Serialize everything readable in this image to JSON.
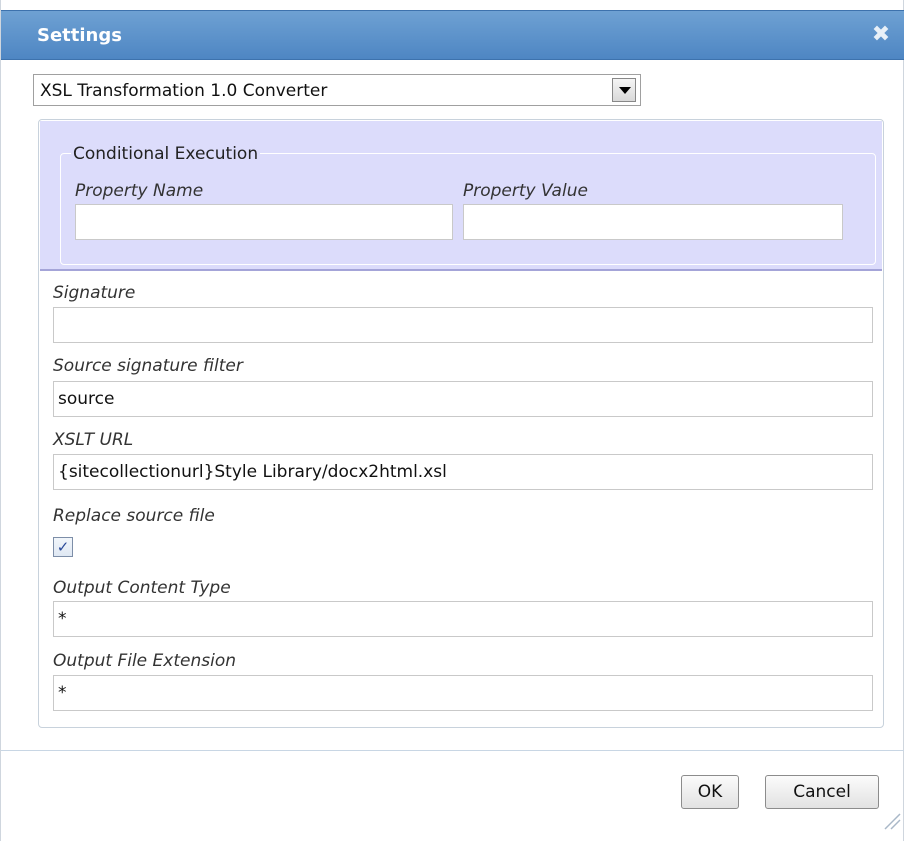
{
  "dialog": {
    "title": "Settings",
    "close_icon": "close-icon"
  },
  "converter_select": {
    "selected": "XSL Transformation 1.0 Converter"
  },
  "conditional_execution": {
    "legend": "Conditional Execution",
    "property_name_label": "Property Name",
    "property_name_value": "",
    "property_value_label": "Property Value",
    "property_value_value": ""
  },
  "fields": {
    "signature_label": "Signature",
    "signature_value": "",
    "source_filter_label": "Source signature filter",
    "source_filter_value": "source",
    "xslt_url_label": "XSLT URL",
    "xslt_url_value": "{sitecollectionurl}Style Library/docx2html.xsl",
    "replace_source_label": "Replace source file",
    "replace_source_checked": true,
    "output_content_type_label": "Output Content Type",
    "output_content_type_value": "*",
    "output_file_extension_label": "Output File Extension",
    "output_file_extension_value": "*"
  },
  "buttons": {
    "ok": "OK",
    "cancel": "Cancel"
  },
  "colors": {
    "titlebar": "#4e86c3",
    "conditional_bg": "#dcdcfb"
  }
}
